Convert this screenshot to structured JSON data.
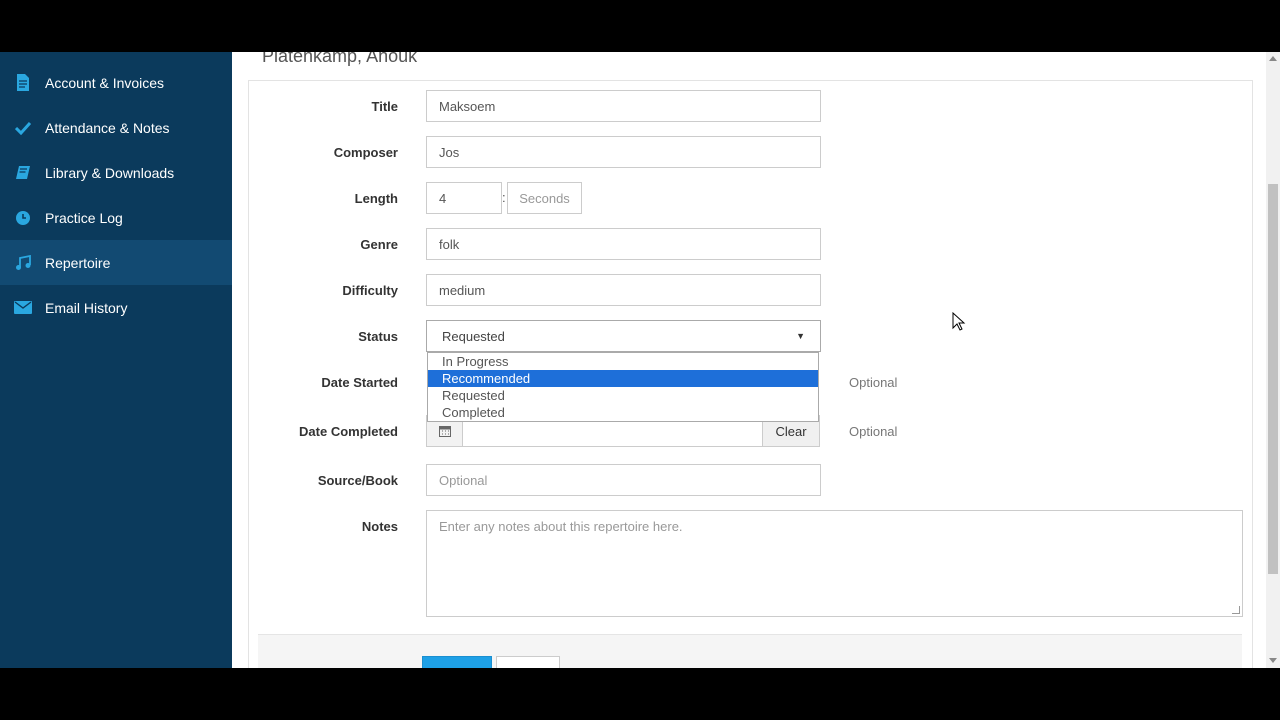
{
  "sidebar": {
    "items": [
      {
        "label": "Account & Invoices",
        "icon": "document-icon"
      },
      {
        "label": "Attendance & Notes",
        "icon": "checkmark-icon"
      },
      {
        "label": "Library & Downloads",
        "icon": "book-icon"
      },
      {
        "label": "Practice Log",
        "icon": "clock-icon"
      },
      {
        "label": "Repertoire",
        "icon": "music-note-icon",
        "active": true
      },
      {
        "label": "Email History",
        "icon": "envelope-icon"
      }
    ]
  },
  "header": {
    "client_name": "Platenkamp, Anouk"
  },
  "form": {
    "title": {
      "label": "Title",
      "value": "Maksoem"
    },
    "composer": {
      "label": "Composer",
      "value": "Jos"
    },
    "length": {
      "label": "Length",
      "value": "4",
      "separator": ":",
      "seconds_placeholder": "Seconds"
    },
    "genre": {
      "label": "Genre",
      "value": "folk"
    },
    "difficulty": {
      "label": "Difficulty",
      "value": "medium"
    },
    "status": {
      "label": "Status",
      "selected": "Requested",
      "options": [
        "In Progress",
        "Recommended",
        "Requested",
        "Completed"
      ],
      "highlighted": "Recommended"
    },
    "date_started": {
      "label": "Date Started",
      "hint": "Optional"
    },
    "date_completed": {
      "label": "Date Completed",
      "hint": "Optional",
      "clear_label": "Clear"
    },
    "source_book": {
      "label": "Source/Book",
      "placeholder": "Optional"
    },
    "notes": {
      "label": "Notes",
      "placeholder": "Enter any notes about this repertoire here."
    }
  },
  "colors": {
    "sidebar_bg": "#0b3a5c",
    "sidebar_active": "#124a72",
    "icon_accent": "#2aa7e0",
    "dropdown_highlight": "#1e6fd9",
    "save_button": "#1ea0e6"
  }
}
